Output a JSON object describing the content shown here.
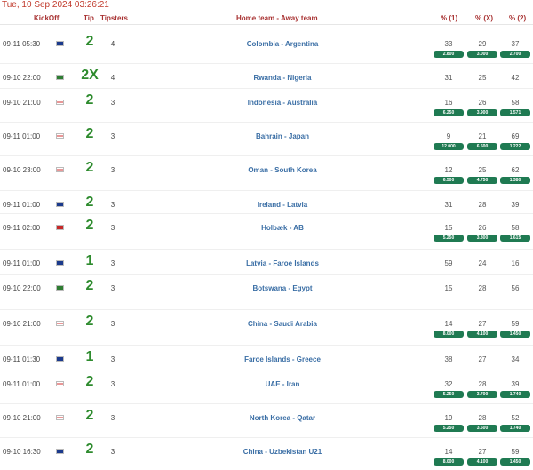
{
  "datetime": "Tue, 10 Sep 2024 03:26:21",
  "headers": {
    "kickoff": "KickOff",
    "tip": "Tip",
    "tipsters": "Tipsters",
    "teams": "Home team - Away team",
    "p1": "% (1)",
    "px": "% (X)",
    "p2": "% (2)"
  },
  "colors": {
    "accent": "#a83232",
    "tip": "#2e8b2e",
    "team_link": "#3a6ea5",
    "odds_badge": "#1f7a52"
  },
  "rows": [
    {
      "kickoff": "09-11 05:30",
      "flag_icon": "flag-icon",
      "tip": "2",
      "tipsters": "4",
      "match": "Colombia - Argentina",
      "p1": "33",
      "px": "29",
      "p2": "37",
      "o1": "2.800",
      "ox": "3.000",
      "o2": "2.700"
    },
    {
      "kickoff": "09-10 22:00",
      "flag_icon": "flag-icon",
      "tip": "2X",
      "tipsters": "4",
      "match": "Rwanda - Nigeria",
      "p1": "31",
      "px": "25",
      "p2": "42",
      "o1": "",
      "ox": "",
      "o2": ""
    },
    {
      "kickoff": "09-10 21:00",
      "flag_icon": "flag-icon",
      "tip": "2",
      "tipsters": "3",
      "match": "Indonesia - Australia",
      "p1": "16",
      "px": "26",
      "p2": "58",
      "o1": "6.250",
      "ox": "3.900",
      "o2": "1.571"
    },
    {
      "kickoff": "09-11 01:00",
      "flag_icon": "flag-icon",
      "tip": "2",
      "tipsters": "3",
      "match": "Bahrain - Japan",
      "p1": "9",
      "px": "21",
      "p2": "69",
      "o1": "12.000",
      "ox": "6.500",
      "o2": "1.222"
    },
    {
      "kickoff": "09-10 23:00",
      "flag_icon": "flag-icon",
      "tip": "2",
      "tipsters": "3",
      "match": "Oman - South Korea",
      "p1": "12",
      "px": "25",
      "p2": "62",
      "o1": "6.500",
      "ox": "4.750",
      "o2": "1.380"
    },
    {
      "kickoff": "09-11 01:00",
      "flag_icon": "flag-icon",
      "tip": "2",
      "tipsters": "3",
      "match": "Ireland - Latvia",
      "p1": "31",
      "px": "28",
      "p2": "39",
      "o1": "",
      "ox": "",
      "o2": ""
    },
    {
      "kickoff": "09-11 02:00",
      "flag_icon": "flag-icon",
      "tip": "2",
      "tipsters": "3",
      "match": "Holbæk - AB",
      "p1": "15",
      "px": "26",
      "p2": "58",
      "o1": "5.250",
      "ox": "3.800",
      "o2": "1.615"
    },
    {
      "kickoff": "09-11 01:00",
      "flag_icon": "flag-icon",
      "tip": "1",
      "tipsters": "3",
      "match": "Latvia - Faroe Islands",
      "p1": "59",
      "px": "24",
      "p2": "16",
      "o1": "",
      "ox": "",
      "o2": ""
    },
    {
      "kickoff": "09-10 22:00",
      "flag_icon": "flag-icon",
      "tip": "2",
      "tipsters": "3",
      "match": "Botswana - Egypt",
      "p1": "15",
      "px": "28",
      "p2": "56",
      "o1": "",
      "ox": "",
      "o2": ""
    },
    {
      "kickoff": "09-10 21:00",
      "flag_icon": "flag-icon",
      "tip": "2",
      "tipsters": "3",
      "match": "China - Saudi Arabia",
      "p1": "14",
      "px": "27",
      "p2": "59",
      "o1": "8.000",
      "ox": "4.100",
      "o2": "1.450"
    },
    {
      "kickoff": "09-11 01:30",
      "flag_icon": "flag-icon",
      "tip": "1",
      "tipsters": "3",
      "match": "Faroe Islands - Greece",
      "p1": "38",
      "px": "27",
      "p2": "34",
      "o1": "",
      "ox": "",
      "o2": ""
    },
    {
      "kickoff": "09-11 01:00",
      "flag_icon": "flag-icon",
      "tip": "2",
      "tipsters": "3",
      "match": "UAE - Iran",
      "p1": "32",
      "px": "28",
      "p2": "39",
      "o1": "5.250",
      "ox": "3.700",
      "o2": "1.740"
    },
    {
      "kickoff": "09-10 21:00",
      "flag_icon": "flag-icon",
      "tip": "2",
      "tipsters": "3",
      "match": "North Korea - Qatar",
      "p1": "19",
      "px": "28",
      "p2": "52",
      "o1": "5.250",
      "ox": "3.600",
      "o2": "1.740"
    },
    {
      "kickoff": "09-10 16:30",
      "flag_icon": "flag-icon",
      "tip": "2",
      "tipsters": "3",
      "match": "China - Uzbekistan U21",
      "p1": "14",
      "px": "27",
      "p2": "59",
      "o1": "8.000",
      "ox": "4.100",
      "o2": "1.450"
    }
  ]
}
